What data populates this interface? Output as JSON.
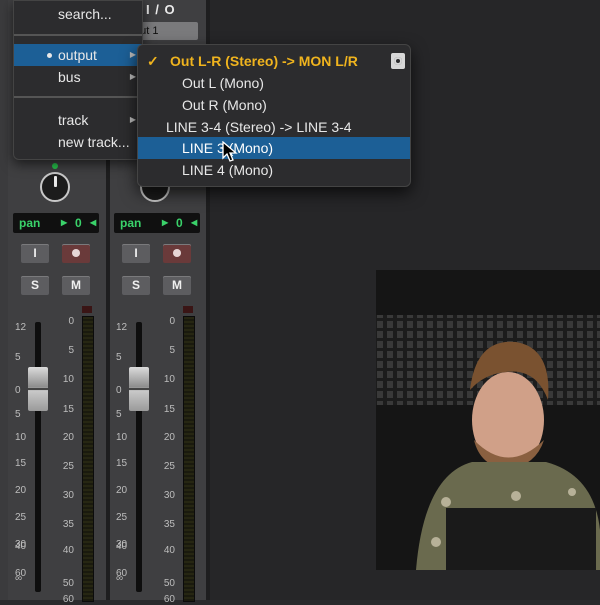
{
  "strips": [
    {
      "io_header": "",
      "io_select": "",
      "pan": {
        "label": "pan",
        "value": "0"
      },
      "input_button": "I",
      "solo_button": "S",
      "mute_button": "M",
      "fader_scale": [
        "12",
        "5",
        "0",
        "5",
        "10",
        "15",
        "20",
        "25",
        "30",
        "40",
        "60",
        "∞"
      ],
      "meter_scale": [
        "0",
        "5",
        "10",
        "15",
        "20",
        "25",
        "30",
        "35",
        "40",
        "50",
        "60"
      ]
    },
    {
      "io_header": "I / O",
      "io_select": "put 1",
      "pan": {
        "label": "pan",
        "value": "0"
      },
      "input_button": "I",
      "solo_button": "S",
      "mute_button": "M",
      "fader_scale": [
        "12",
        "5",
        "0",
        "5",
        "10",
        "15",
        "20",
        "25",
        "30",
        "40",
        "60",
        "∞"
      ],
      "meter_scale": [
        "0",
        "5",
        "10",
        "15",
        "20",
        "25",
        "30",
        "35",
        "40",
        "50",
        "60"
      ]
    }
  ],
  "main_menu": {
    "items": [
      {
        "label": "search...",
        "arrow": ""
      },
      {
        "label": "output",
        "arrow": "▶",
        "selected": true
      },
      {
        "label": "bus",
        "arrow": "▶"
      },
      {
        "label": "track",
        "arrow": "▶"
      },
      {
        "label": "new track...",
        "arrow": ""
      }
    ]
  },
  "output_submenu": {
    "items": [
      {
        "label": "Out L-R (Stereo) -> MON L/R",
        "checked": true,
        "check": "✓"
      },
      {
        "label": "Out L (Mono)"
      },
      {
        "label": "Out R (Mono)"
      },
      {
        "label": "LINE 3-4 (Stereo) -> LINE 3-4"
      },
      {
        "label": "LINE 3 (Mono)",
        "highlighted": true
      },
      {
        "label": "LINE 4 (Mono)"
      }
    ]
  },
  "colors": {
    "highlight": "#1c5f96",
    "checked_item": "#f0b41e",
    "pan_text": "#3ad26a",
    "led": "#27c24c"
  },
  "icons": [
    "speaker-icon",
    "cursor-icon",
    "knob-icon",
    "record-icon",
    "checkmark-icon",
    "submenu-arrow-icon"
  ]
}
